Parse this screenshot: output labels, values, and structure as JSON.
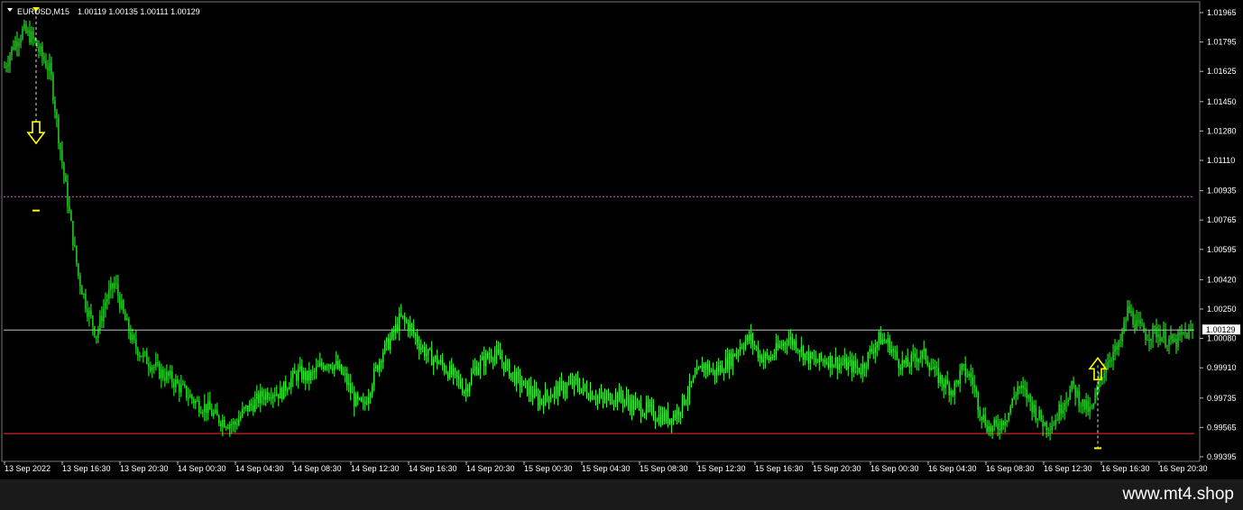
{
  "header": {
    "symbol": "EURUSD,M15",
    "ohlc": "1.00119 1.00135 1.00111 1.00129",
    "menu_icon": "triangle-down-icon"
  },
  "price_axis": {
    "labels": [
      "1.01965",
      "1.01795",
      "1.01625",
      "1.01450",
      "1.01280",
      "1.01110",
      "1.00935",
      "1.00765",
      "1.00595",
      "1.00420",
      "1.00250",
      "1.00080",
      "0.99910",
      "0.99735",
      "0.99565",
      "0.99395"
    ],
    "current_price": "1.00129"
  },
  "time_axis": {
    "labels": [
      "13 Sep 2022",
      "13 Sep 16:30",
      "13 Sep 20:30",
      "14 Sep 00:30",
      "14 Sep 04:30",
      "14 Sep 08:30",
      "14 Sep 12:30",
      "14 Sep 16:30",
      "14 Sep 20:30",
      "15 Sep 00:30",
      "15 Sep 04:30",
      "15 Sep 08:30",
      "15 Sep 12:30",
      "15 Sep 16:30",
      "15 Sep 20:30",
      "16 Sep 00:30",
      "16 Sep 04:30",
      "16 Sep 08:30",
      "16 Sep 12:30",
      "16 Sep 16:30",
      "16 Sep 20:30"
    ]
  },
  "chart_data": {
    "type": "candlestick",
    "symbol": "EURUSD",
    "timeframe": "M15",
    "ylim": [
      0.99395,
      1.02025
    ],
    "x_range": [
      "13 Sep 2022",
      "16 Sep 20:30"
    ],
    "grid": false,
    "series": [
      {
        "name": "price_path",
        "values": [
          1.0165,
          1.0178,
          1.0186,
          1.0182,
          1.0172,
          1.0162,
          1.012,
          1.0082,
          1.0045,
          1.0025,
          1.001,
          1.003,
          1.004,
          1.002,
          1.0005,
          0.9998,
          0.9993,
          0.9988,
          0.9985,
          0.998,
          0.9975,
          0.997,
          0.9968,
          0.9962,
          0.996,
          0.9958,
          0.9966,
          0.997,
          0.9975,
          0.9978,
          0.9976,
          0.9984,
          0.9988,
          0.9985,
          0.999,
          0.9995,
          0.9992,
          0.9985,
          0.9972,
          0.9968,
          0.9985,
          1.0,
          1.0008,
          1.002,
          1.0015,
          1.0005,
          0.9998,
          0.9995,
          0.999,
          0.9985,
          0.9978,
          0.999,
          0.9995,
          1.0,
          0.9995,
          0.9988,
          0.9982,
          0.9978,
          0.9972,
          0.9975,
          0.9978,
          0.998,
          0.9982,
          0.9978,
          0.9976,
          0.9972,
          0.9975,
          0.9974,
          0.997,
          0.9968,
          0.9966,
          0.9963,
          0.9962,
          0.9965,
          0.9975,
          0.9985,
          0.9993,
          0.9988,
          0.9992,
          0.9997,
          1.0005,
          1.0008,
          0.9998,
          0.9996,
          1.0002,
          1.0008,
          1.0005,
          0.9998,
          0.9994,
          0.9996,
          0.9995,
          0.9993,
          0.9992,
          0.999,
          1.0,
          1.0008,
          1.0005,
          0.9995,
          0.9992,
          0.9998,
          0.9998,
          0.9988,
          0.9982,
          0.9978,
          0.999,
          0.9985,
          0.9965,
          0.9955,
          0.9958,
          0.9965,
          0.998,
          0.9975,
          0.9965,
          0.9958,
          0.996,
          0.9972,
          0.998,
          0.997,
          0.9965,
          0.9985,
          0.9998,
          1.0002,
          1.0025,
          1.0015,
          1.001,
          1.0012,
          1.0008,
          1.0005,
          1.001,
          1.0012
        ]
      }
    ],
    "horizontal_lines": [
      {
        "level": 1.009,
        "color": "#d45ad4",
        "style": "dotted"
      },
      {
        "level": 1.00129,
        "color": "#c0c0c0",
        "style": "solid"
      },
      {
        "level": 0.9953,
        "color": "#ff2a2a",
        "style": "solid"
      }
    ],
    "signals": [
      {
        "type": "sell",
        "x_label": "13 Sep 2022",
        "price": 1.0125,
        "stop": 1.0082,
        "icon": "down-arrow-icon"
      },
      {
        "type": "buy",
        "x_label": "16 Sep 16:30",
        "price": 0.99925,
        "stop": 0.99445,
        "icon": "up-arrow-icon"
      }
    ],
    "colors": {
      "background": "#000000",
      "candles": "#33ff33",
      "axis_text": "#ffffff",
      "signal": "#ffff00",
      "price_tag_bg": "#ffffff",
      "price_tag_text": "#000000"
    }
  },
  "footer": {
    "watermark": "www.mt4.shop"
  }
}
